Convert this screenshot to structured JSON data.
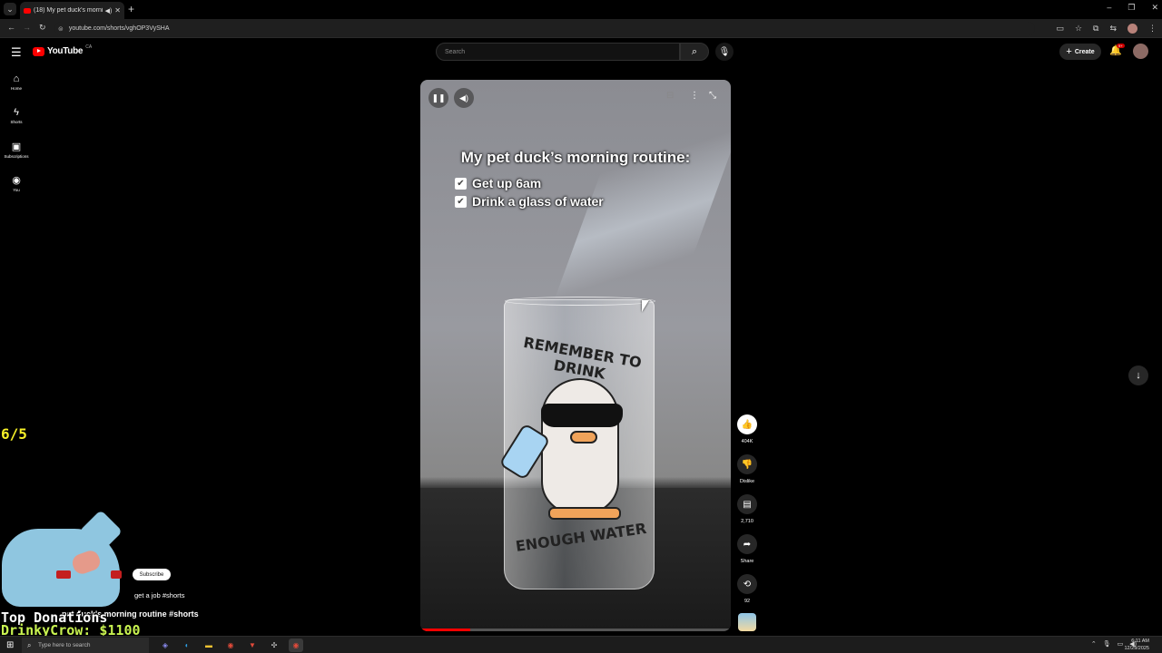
{
  "browser": {
    "tab_title": "(18) My pet duck's morning...",
    "url": "youtube.com/shorts/vghOP3VySHA"
  },
  "header": {
    "logo_text": "YouTube",
    "region": "CA",
    "search_placeholder": "Search",
    "create_label": "Create",
    "notification_count": "9+"
  },
  "sidebar": {
    "items": [
      {
        "label": "Home",
        "icon": "home-icon"
      },
      {
        "label": "Shorts",
        "icon": "shorts-icon"
      },
      {
        "label": "Subscriptions",
        "icon": "subscriptions-icon"
      },
      {
        "label": "You",
        "icon": "you-icon"
      }
    ]
  },
  "video": {
    "overlay_title": "My pet duck’s morning routine:",
    "checklist": [
      "Get up 6am",
      "Drink a glass of water"
    ],
    "glass_text_top": "REMEMBER TO DRINK",
    "glass_text_bottom": "ENOUGH WATER",
    "progress_fraction": 0.16
  },
  "actions": {
    "like_count": "404K",
    "dislike_label": "Dislike",
    "comment_count": "2,710",
    "share_label": "Share",
    "remix_count": "92"
  },
  "channel": {
    "subscribe_label": "Subscribe",
    "description_fragment": "get a job #shorts",
    "short_title_fragment": "pet duck's morning routine #shorts"
  },
  "stream_overlay": {
    "score": "6/5",
    "donations_heading": "Top Donations",
    "top_donor": "DrinkyCrow: $1100"
  },
  "taskbar": {
    "search_placeholder": "Type here to search",
    "time": "6:11 AM",
    "date": "12/29/2025"
  }
}
